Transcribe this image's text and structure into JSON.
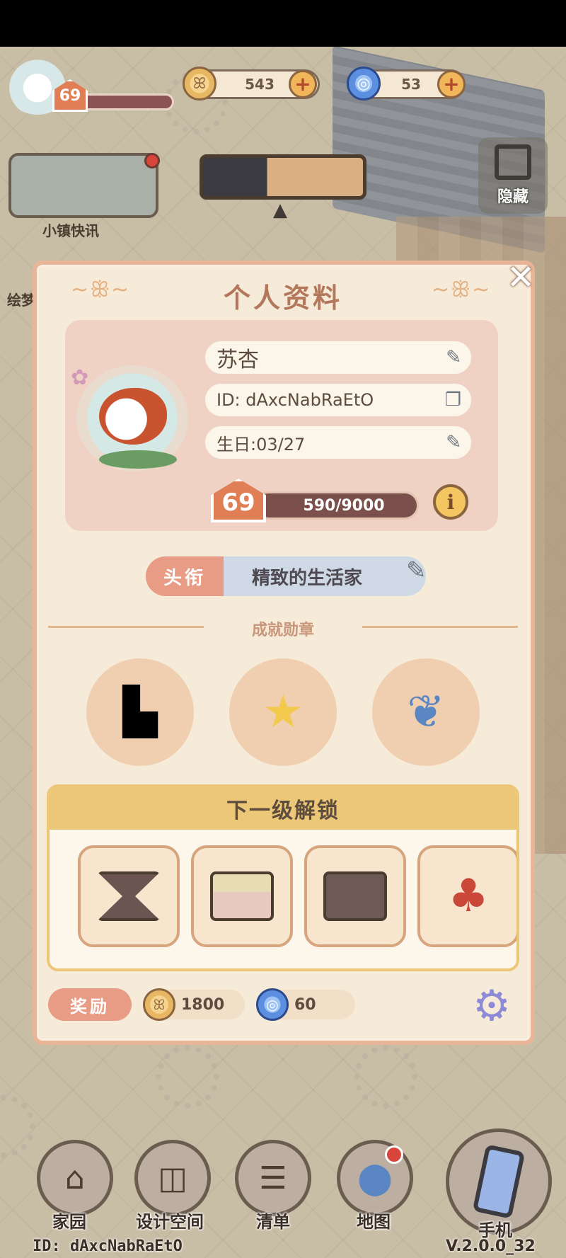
{
  "hud": {
    "player_level": "69",
    "coins": "543",
    "gems": "53",
    "coin_plus": "+",
    "gem_plus": "+",
    "news_label": "小镇快讯",
    "side_label": "绘梦",
    "hide_label": "隐藏"
  },
  "modal": {
    "title": "个人资料",
    "close": "✕",
    "swirl_left": "~ꕥ~",
    "swirl_right": "~ꕥ~",
    "profile": {
      "name": "苏杏",
      "id": "ID: dAxcNabRaEtO",
      "birthday": "生日:03/27",
      "level": "69",
      "xp_text": "590/9000",
      "xp_current": 590,
      "xp_max": 9000,
      "info": "i"
    },
    "title_tag": "头衔",
    "title_value": "精致的生活家",
    "achievements_header": "成就勋章",
    "badges": [
      {
        "icon": "paint-roller-icon",
        "glyph": "🧱"
      },
      {
        "icon": "rainbow-star-scroll-icon",
        "glyph": "⭐"
      },
      {
        "icon": "koi-fish-icon",
        "glyph": "🐟"
      }
    ],
    "unlock": {
      "header": "下一级解锁",
      "items": [
        {
          "icon": "hourglass-table-icon",
          "color": "#6b5550"
        },
        {
          "icon": "layered-box-icon",
          "color": "#e8c9c0"
        },
        {
          "icon": "dark-box-icon",
          "color": "#6d5a57"
        },
        {
          "icon": "mushroom-icon",
          "color": "#c9483a"
        }
      ]
    },
    "reward_label": "奖励",
    "reward_coins": "1800",
    "reward_gems": "60"
  },
  "nav": {
    "home": "家园",
    "design": "设计空间",
    "list": "清单",
    "map": "地图",
    "phone": "手机"
  },
  "footer": {
    "id": "ID: dAxcNabRaEtO",
    "version": "V.2.0.0_32"
  },
  "colors": {
    "accent": "#e07f56",
    "panel": "#f6ebd9",
    "title": "#b3775c",
    "tag": "#e99c85"
  }
}
